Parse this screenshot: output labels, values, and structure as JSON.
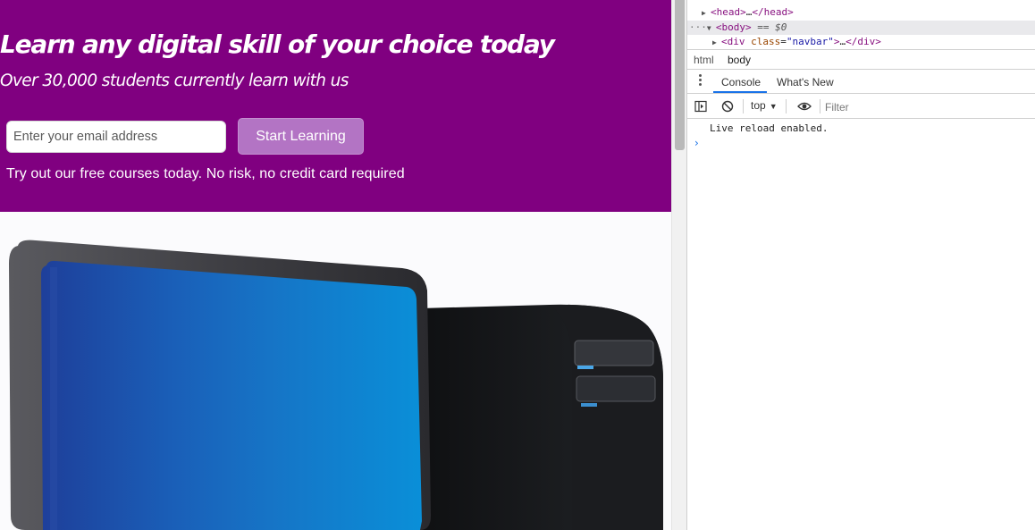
{
  "page": {
    "hero": {
      "title": "Learn any digital skill of your choice today",
      "subtitle": "Over 30,000 students currently learn with us",
      "email_placeholder": "Enter your email address",
      "cta_label": "Start Learning",
      "note": "Try out our free courses today. No risk, no credit card required",
      "background_color": "#800080"
    }
  },
  "devtools": {
    "dom": {
      "head_open": "<head>",
      "head_ellipsis": "…",
      "head_close": "</head>",
      "body_open": "<body>",
      "body_marker": "== $0",
      "div_tag_open": "<div ",
      "div_attr_name": "class",
      "div_attr_eq": "=",
      "div_attr_val": "\"navbar\"",
      "div_tag_end": ">",
      "div_ellipsis": "…",
      "div_close": "</div>"
    },
    "breadcrumbs": [
      "html",
      "body"
    ],
    "tabs": [
      "Console",
      "What's New"
    ],
    "toolbar": {
      "context": "top",
      "filter_placeholder": "Filter"
    },
    "console": {
      "messages": [
        "Live reload enabled."
      ],
      "prompt": "›"
    },
    "icons": [
      "sidebar-toggle-icon",
      "clear-console-icon",
      "dropdown-arrow-icon",
      "eye-icon"
    ]
  }
}
